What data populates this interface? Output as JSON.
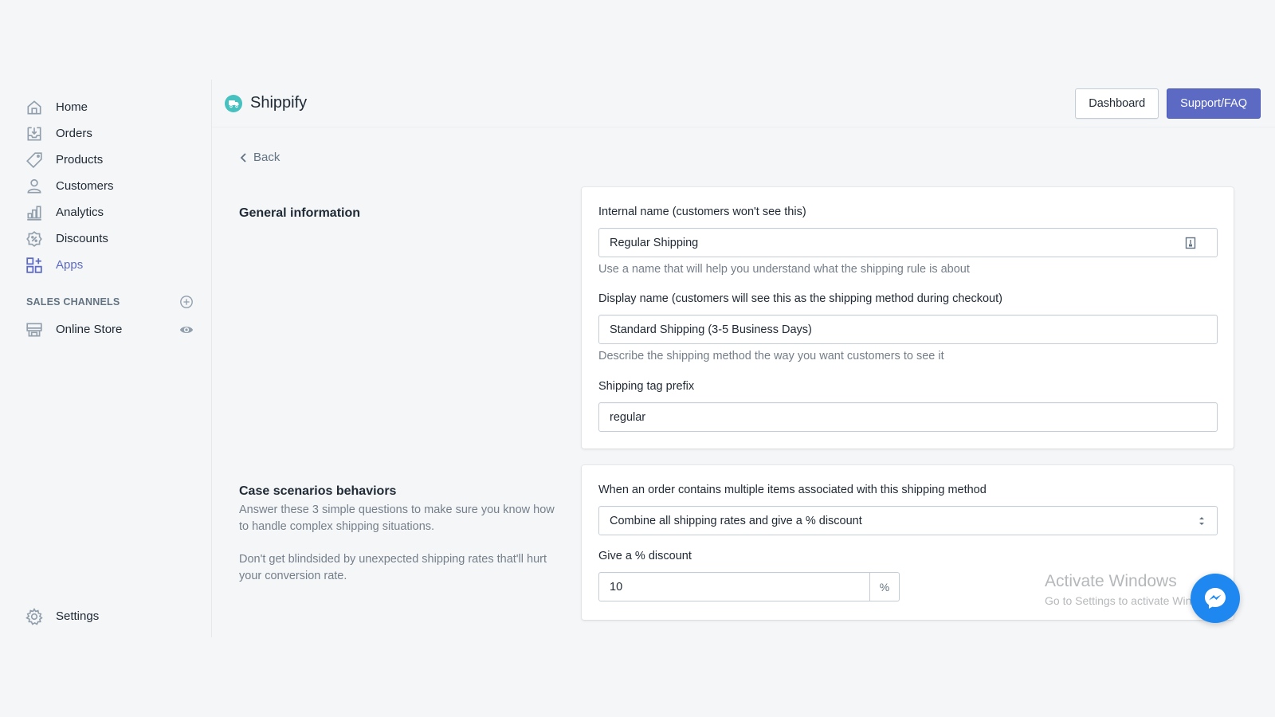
{
  "sidebar": {
    "items": [
      {
        "label": "Home",
        "icon": "home-icon"
      },
      {
        "label": "Orders",
        "icon": "orders-icon"
      },
      {
        "label": "Products",
        "icon": "tag-icon"
      },
      {
        "label": "Customers",
        "icon": "customer-icon"
      },
      {
        "label": "Analytics",
        "icon": "analytics-icon"
      },
      {
        "label": "Discounts",
        "icon": "discount-icon"
      },
      {
        "label": "Apps",
        "icon": "apps-icon",
        "active": true
      }
    ],
    "sales_channels_title": "SALES CHANNELS",
    "online_store_label": "Online Store",
    "settings_label": "Settings"
  },
  "header": {
    "app_name": "Shippify",
    "dashboard_label": "Dashboard",
    "support_label": "Support/FAQ"
  },
  "back_label": "Back",
  "general": {
    "title": "General information",
    "internal_name_label": "Internal name (customers won't see this)",
    "internal_name_value": "Regular Shipping",
    "internal_name_help": "Use a name that will help you understand what the shipping rule is about",
    "display_name_label": "Display name (customers will see this as the shipping method during checkout)",
    "display_name_value": "Standard Shipping (3-5 Business Days)",
    "display_name_help": "Describe the shipping method the way you want customers to see it",
    "tag_prefix_label": "Shipping tag prefix",
    "tag_prefix_value": "regular"
  },
  "case": {
    "title": "Case scenarios behaviors",
    "desc1": "Answer these 3 simple questions to make sure you know how to handle complex shipping situations.",
    "desc2": "Don't get blindsided by unexpected shipping rates that'll hurt your conversion rate.",
    "multiple_items_label": "When an order contains multiple items associated with this shipping method",
    "multiple_items_value": "Combine all shipping rates and give a % discount",
    "discount_label": "Give a % discount",
    "discount_value": "10",
    "discount_suffix": "%"
  },
  "watermark": {
    "line1": "Activate Windows",
    "line2": "Go to Settings to activate Windows."
  },
  "colors": {
    "primary": "#5c6ac4",
    "messenger": "#1e88f0",
    "logo": "#47c1bf"
  }
}
